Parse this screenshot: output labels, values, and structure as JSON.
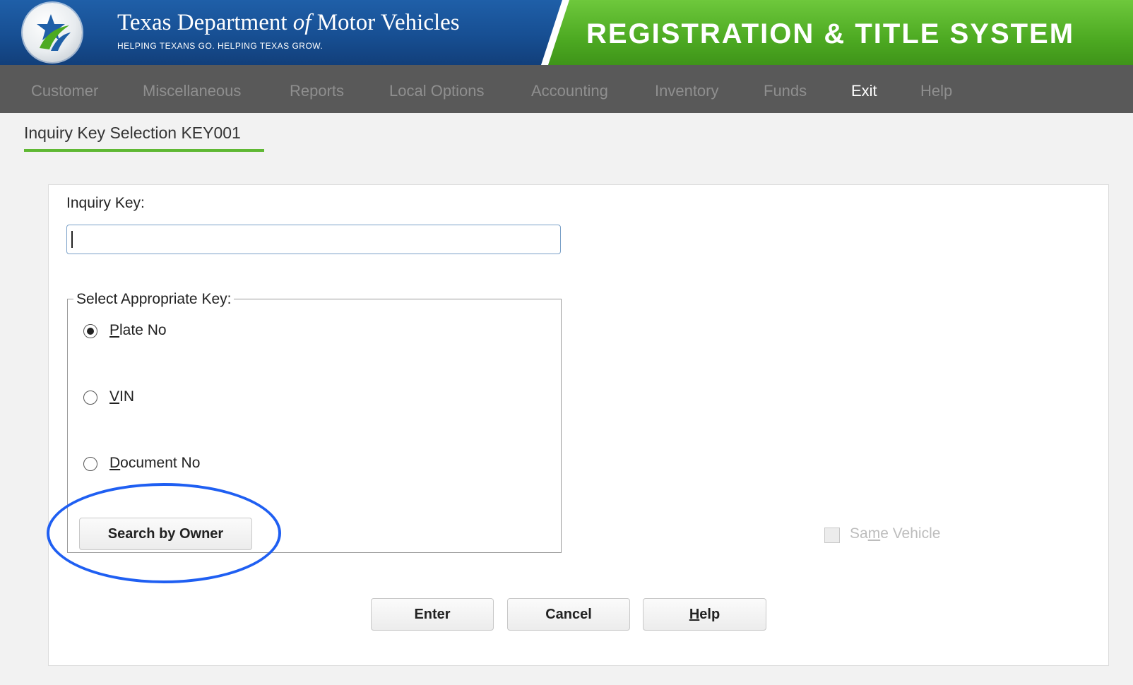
{
  "header": {
    "agency_name_part1": "Texas Department ",
    "agency_name_of": "of",
    "agency_name_part2": " Motor Vehicles",
    "agency_tagline": "HELPING TEXANS GO. HELPING TEXAS GROW.",
    "system_title": "REGISTRATION & TITLE SYSTEM",
    "colors": {
      "blue": "#1f5fa8",
      "green": "#4daa22"
    }
  },
  "menu": {
    "items": [
      {
        "label": "Customer",
        "active": false
      },
      {
        "label": "Miscellaneous",
        "active": false
      },
      {
        "label": "Reports",
        "active": false
      },
      {
        "label": "Local Options",
        "active": false
      },
      {
        "label": "Accounting",
        "active": false
      },
      {
        "label": "Inventory",
        "active": false
      },
      {
        "label": "Funds",
        "active": false
      },
      {
        "label": "Exit",
        "active": true
      },
      {
        "label": "Help",
        "active": false
      }
    ]
  },
  "page": {
    "title": "Inquiry Key Selection KEY001",
    "accent_color": "#5fb833"
  },
  "form": {
    "inquiry_label": "Inquiry Key:",
    "inquiry_value": "",
    "key_group_legend": "Select Appropriate Key:",
    "options": {
      "plate": {
        "accesskey": "P",
        "rest": "late No",
        "selected": true
      },
      "vin": {
        "accesskey": "V",
        "rest": "IN",
        "selected": false
      },
      "document": {
        "accesskey": "D",
        "rest": "ocument No",
        "selected": false
      }
    },
    "search_by_owner_label": "Search by Owner",
    "same_vehicle": {
      "before": "Sa",
      "accesskey": "m",
      "after": "e Vehicle",
      "checked": false,
      "enabled": false
    }
  },
  "buttons": {
    "enter": "Enter",
    "cancel": "Cancel",
    "help_accesskey": "H",
    "help_rest": "elp"
  },
  "annotation": {
    "circle_color": "#1f5ff2"
  }
}
